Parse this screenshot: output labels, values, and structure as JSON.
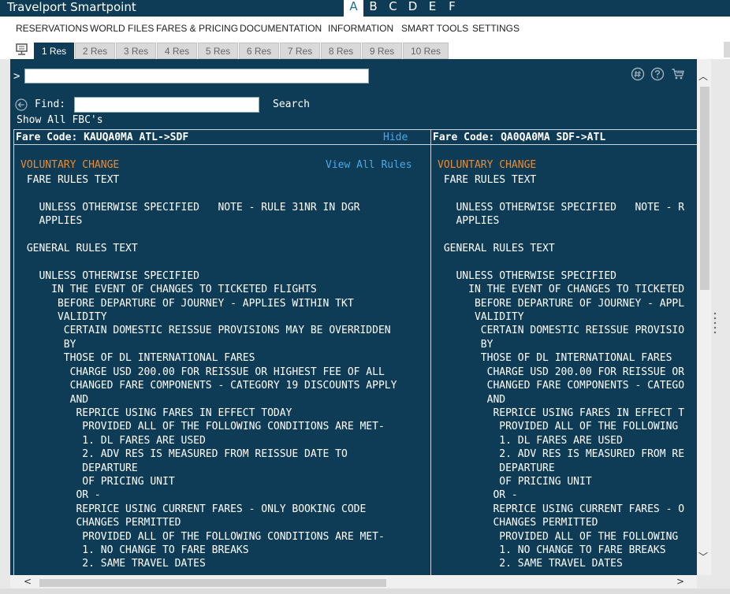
{
  "app": {
    "title": "Travelport Smartpoint"
  },
  "screen_tabs": [
    "A",
    "B",
    "C",
    "D",
    "E",
    "F"
  ],
  "menu": [
    "RESERVATIONS",
    "WORLD FILES",
    "FARES & PRICING",
    "DOCUMENTATION",
    "INFORMATION",
    "SMART TOOLS",
    "SETTINGS"
  ],
  "res_tabs": [
    "1 Res",
    "2 Res",
    "3 Res",
    "4 Res",
    "5 Res",
    "6 Res",
    "7 Res",
    "8 Res",
    "9 Res",
    "10 Res"
  ],
  "terminal": {
    "prompt": ">",
    "command_value": "",
    "find_label": "Find:",
    "find_value": "",
    "search_label": "Search",
    "show_all_fbc": "Show All FBC's"
  },
  "panels": {
    "left": {
      "fare_code": "Fare Code: KAUQA0MA ATL->SDF",
      "hide_label": "Hide",
      "section_title": "VOLUNTARY CHANGE",
      "view_all_rules": "View All Rules",
      "lines": [
        " FARE RULES TEXT",
        "",
        "   UNLESS OTHERWISE SPECIFIED   NOTE - RULE 31NR IN DGR",
        "   APPLIES",
        "",
        " GENERAL RULES TEXT",
        "",
        "   UNLESS OTHERWISE SPECIFIED",
        "     IN THE EVENT OF CHANGES TO TICKETED FLIGHTS",
        "      BEFORE DEPARTURE OF JOURNEY - APPLIES WITHIN TKT",
        "      VALIDITY",
        "       CERTAIN DOMESTIC REISSUE PROVISIONS MAY BE OVERRIDDEN",
        "       BY",
        "       THOSE OF DL INTERNATIONAL FARES",
        "        CHARGE USD 200.00 FOR REISSUE OR HIGHEST FEE OF ALL",
        "        CHANGED FARE COMPONENTS - CATEGORY 19 DISCOUNTS APPLY",
        "        AND",
        "         REPRICE USING FARES IN EFFECT TODAY",
        "          PROVIDED ALL OF THE FOLLOWING CONDITIONS ARE MET-",
        "          1. DL FARES ARE USED",
        "          2. ADV RES IS MEASURED FROM REISSUE DATE TO",
        "          DEPARTURE",
        "          OF PRICING UNIT",
        "         OR -",
        "         REPRICE USING CURRENT FARES - ONLY BOOKING CODE",
        "         CHANGES PERMITTED",
        "          PROVIDED ALL OF THE FOLLOWING CONDITIONS ARE MET-",
        "          1. NO CHANGE TO FARE BREAKS",
        "          2. SAME TRAVEL DATES"
      ]
    },
    "right": {
      "fare_code": "Fare Code: QA0QA0MA SDF->ATL",
      "section_title": "VOLUNTARY CHANGE",
      "lines": [
        " FARE RULES TEXT",
        "",
        "   UNLESS OTHERWISE SPECIFIED   NOTE - R",
        "   APPLIES",
        "",
        " GENERAL RULES TEXT",
        "",
        "   UNLESS OTHERWISE SPECIFIED",
        "     IN THE EVENT OF CHANGES TO TICKETED",
        "      BEFORE DEPARTURE OF JOURNEY - APPL",
        "      VALIDITY",
        "       CERTAIN DOMESTIC REISSUE PROVISIO",
        "       BY",
        "       THOSE OF DL INTERNATIONAL FARES",
        "        CHARGE USD 200.00 FOR REISSUE OR",
        "        CHANGED FARE COMPONENTS - CATEGO",
        "        AND",
        "         REPRICE USING FARES IN EFFECT T",
        "          PROVIDED ALL OF THE FOLLOWING",
        "          1. DL FARES ARE USED",
        "          2. ADV RES IS MEASURED FROM RE",
        "          DEPARTURE",
        "          OF PRICING UNIT",
        "         OR -",
        "         REPRICE USING CURRENT FARES - O",
        "         CHANGES PERMITTED",
        "          PROVIDED ALL OF THE FOLLOWING",
        "          1. NO CHANGE TO FARE BREAKS",
        "          2. SAME TRAVEL DATES"
      ]
    }
  },
  "icons": {
    "pcc": "hash-circle-icon",
    "help": "help-circle-icon",
    "cart": "shopping-cart-icon",
    "back": "back-circle-icon",
    "terminal": "terminal-monitor-icon"
  },
  "colors": {
    "terminal_bg": "#0e3b55",
    "section_title": "#f08a2c",
    "link": "#4aa8e8",
    "active_tab": "#0e3b55"
  }
}
